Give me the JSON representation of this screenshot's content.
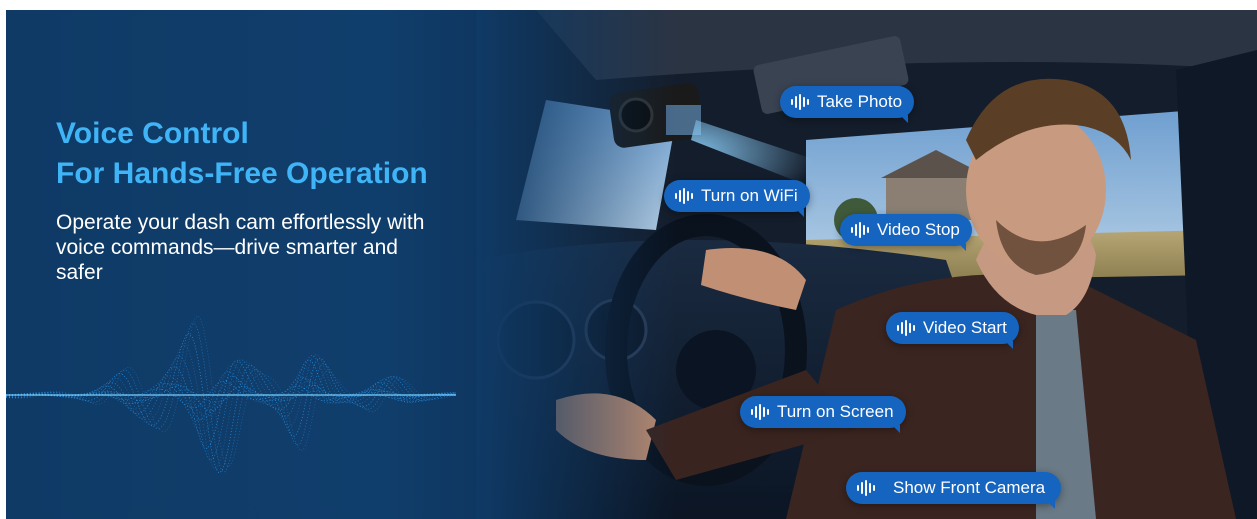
{
  "headline": {
    "line1": "Voice Control",
    "line2": "For Hands-Free Operation"
  },
  "subtitle": "Operate your dash cam effortlessly with voice commands—drive smarter and safer",
  "commands": [
    "Take Photo",
    "Turn on WiFi",
    "Video Stop",
    "Video Start",
    "Turn on Screen",
    "Show Front Camera"
  ],
  "colors": {
    "background": "#0f3a66",
    "headline": "#3fb4f6",
    "pill": "#1565c0",
    "wave": "#2aa3ff"
  },
  "icons": {
    "command": "voice-wave-icon"
  }
}
